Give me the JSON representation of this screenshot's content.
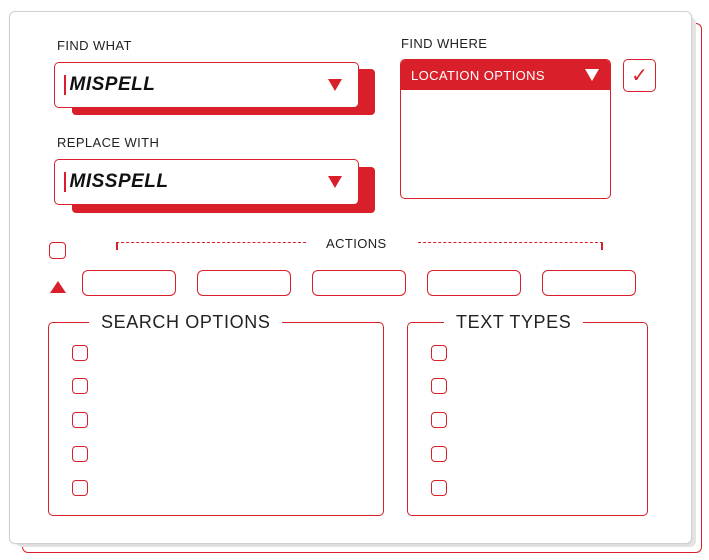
{
  "find_what": {
    "label": "FIND WHAT",
    "value": "MISPELL",
    "dropdown_icon": "triangle-down"
  },
  "replace_with": {
    "label": "REPLACE WITH",
    "value": "MISSPELL",
    "dropdown_icon": "triangle-down"
  },
  "find_where": {
    "label": "FIND WHERE",
    "selected": "LOCATION OPTIONS",
    "dropdown_icon": "triangle-down",
    "confirm_icon": "checkmark",
    "confirm_glyph": "✓"
  },
  "actions": {
    "label": "ACTIONS",
    "buttons": [
      "",
      "",
      "",
      "",
      ""
    ],
    "collapse_icon": "triangle-up"
  },
  "search_options": {
    "title": "SEARCH OPTIONS",
    "items": [
      "",
      "",
      "",
      "",
      ""
    ]
  },
  "text_types": {
    "title": "TEXT TYPES",
    "items": [
      "",
      "",
      "",
      "",
      ""
    ]
  },
  "colors": {
    "accent": "#d9202a",
    "panel_shadow": "#e4e4e4",
    "background": "#ffffff"
  }
}
